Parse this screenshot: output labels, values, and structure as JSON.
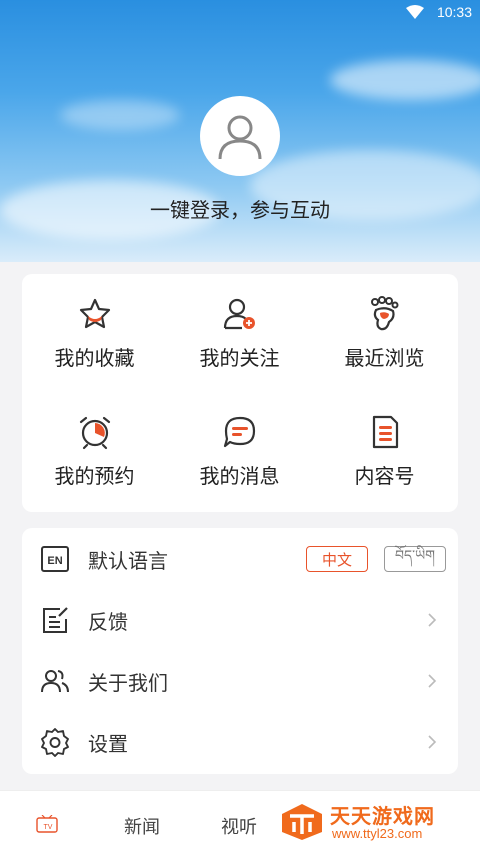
{
  "status_bar": {
    "time": "10:33"
  },
  "profile": {
    "login_prompt": "一键登录，参与互动"
  },
  "grid": {
    "items": [
      {
        "label": "我的收藏",
        "icon": "star-icon"
      },
      {
        "label": "我的关注",
        "icon": "user-follow-icon"
      },
      {
        "label": "最近浏览",
        "icon": "footprint-icon"
      },
      {
        "label": "我的预约",
        "icon": "alarm-clock-icon"
      },
      {
        "label": "我的消息",
        "icon": "message-icon"
      },
      {
        "label": "内容号",
        "icon": "document-icon"
      }
    ]
  },
  "settings": {
    "language": {
      "label": "默认语言",
      "icon": "en-icon",
      "option_zh": "中文",
      "option_bo": "བོད་ཡིག"
    },
    "feedback": {
      "label": "反馈",
      "icon": "feedback-icon"
    },
    "about": {
      "label": "关于我们",
      "icon": "users-icon"
    },
    "settings": {
      "label": "设置",
      "icon": "gear-icon"
    }
  },
  "tabbar": {
    "tv_label": "TV",
    "news": "新闻",
    "video": "视听"
  },
  "watermark": {
    "title": "天天游戏网",
    "url": "www.ttyl23.com"
  },
  "colors": {
    "accent": "#e8532b",
    "sky": "#3a9ae6"
  }
}
